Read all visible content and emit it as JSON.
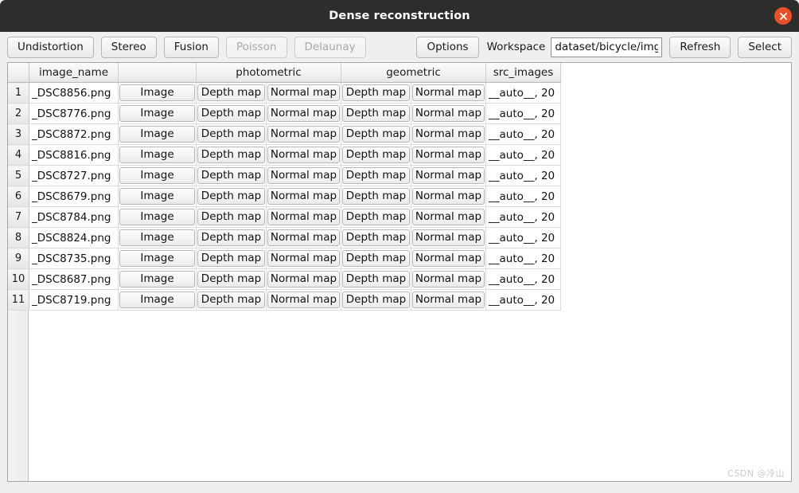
{
  "window": {
    "title": "Dense reconstruction",
    "close_icon": "close-icon",
    "titlebar_color": "#2f2c2c",
    "close_button_color": "#e8502a"
  },
  "toolbar": {
    "buttons": [
      {
        "label": "Undistortion",
        "enabled": true
      },
      {
        "label": "Stereo",
        "enabled": true
      },
      {
        "label": "Fusion",
        "enabled": true
      },
      {
        "label": "Poisson",
        "enabled": false
      },
      {
        "label": "Delaunay",
        "enabled": false
      }
    ],
    "options_label": "Options",
    "workspace_label": "Workspace",
    "workspace_value": "dataset/bicycle/img",
    "workspace_placeholder": "",
    "refresh_label": "Refresh",
    "select_label": "Select"
  },
  "table": {
    "headers": [
      {
        "label": "",
        "key": "corner"
      },
      {
        "label": "image_name",
        "key": "image_name"
      },
      {
        "label": "",
        "key": "image"
      },
      {
        "label": "photometric",
        "key": "photometric",
        "span": 2
      },
      {
        "label": "geometric",
        "key": "geometric",
        "span": 2
      },
      {
        "label": "src_images",
        "key": "src_images"
      }
    ],
    "row_count": 11,
    "rows": [
      {
        "num": "1",
        "image_name": "_DSC8856.png",
        "image": "Image",
        "photometric_depth": "Depth map",
        "photometric_normal": "Normal map",
        "geometric_depth": "Depth map",
        "geometric_normal": "Normal map",
        "src_images": "__auto__, 20"
      },
      {
        "num": "2",
        "image_name": "_DSC8776.png",
        "image": "Image",
        "photometric_depth": "Depth map",
        "photometric_normal": "Normal map",
        "geometric_depth": "Depth map",
        "geometric_normal": "Normal map",
        "src_images": "__auto__, 20"
      },
      {
        "num": "3",
        "image_name": "_DSC8872.png",
        "image": "Image",
        "photometric_depth": "Depth map",
        "photometric_normal": "Normal map",
        "geometric_depth": "Depth map",
        "geometric_normal": "Normal map",
        "src_images": "__auto__, 20"
      },
      {
        "num": "4",
        "image_name": "_DSC8816.png",
        "image": "Image",
        "photometric_depth": "Depth map",
        "photometric_normal": "Normal map",
        "geometric_depth": "Depth map",
        "geometric_normal": "Normal map",
        "src_images": "__auto__, 20"
      },
      {
        "num": "5",
        "image_name": "_DSC8727.png",
        "image": "Image",
        "photometric_depth": "Depth map",
        "photometric_normal": "Normal map",
        "geometric_depth": "Depth map",
        "geometric_normal": "Normal map",
        "src_images": "__auto__, 20"
      },
      {
        "num": "6",
        "image_name": "_DSC8679.png",
        "image": "Image",
        "photometric_depth": "Depth map",
        "photometric_normal": "Normal map",
        "geometric_depth": "Depth map",
        "geometric_normal": "Normal map",
        "src_images": "__auto__, 20"
      },
      {
        "num": "7",
        "image_name": "_DSC8784.png",
        "image": "Image",
        "photometric_depth": "Depth map",
        "photometric_normal": "Normal map",
        "geometric_depth": "Depth map",
        "geometric_normal": "Normal map",
        "src_images": "__auto__, 20"
      },
      {
        "num": "8",
        "image_name": "_DSC8824.png",
        "image": "Image",
        "photometric_depth": "Depth map",
        "photometric_normal": "Normal map",
        "geometric_depth": "Depth map",
        "geometric_normal": "Normal map",
        "src_images": "__auto__, 20"
      },
      {
        "num": "9",
        "image_name": "_DSC8735.png",
        "image": "Image",
        "photometric_depth": "Depth map",
        "photometric_normal": "Normal map",
        "geometric_depth": "Depth map",
        "geometric_normal": "Normal map",
        "src_images": "__auto__, 20"
      },
      {
        "num": "10",
        "image_name": "_DSC8687.png",
        "image": "Image",
        "photometric_depth": "Depth map",
        "photometric_normal": "Normal map",
        "geometric_depth": "Depth map",
        "geometric_normal": "Normal map",
        "src_images": "__auto__, 20"
      },
      {
        "num": "11",
        "image_name": "_DSC8719.png",
        "image": "Image",
        "photometric_depth": "Depth map",
        "photometric_normal": "Normal map",
        "geometric_depth": "Depth map",
        "geometric_normal": "Normal map",
        "src_images": "__auto__, 20"
      }
    ]
  },
  "watermark": {
    "text": "CSDN @冷山"
  }
}
